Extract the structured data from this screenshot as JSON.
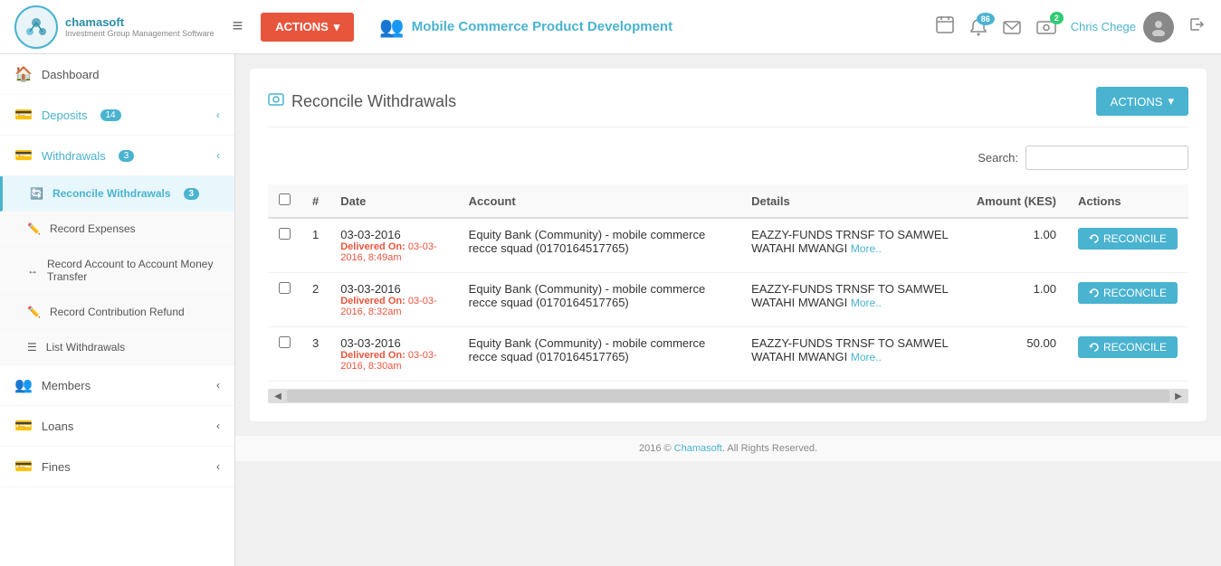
{
  "topnav": {
    "logo_text": "chamasoft",
    "logo_sub": "Investment Group Management Software",
    "hamburger": "≡",
    "actions_btn": "ACTIONS",
    "actions_arrow": "▾",
    "group_name": "Mobile Commerce Product Development",
    "notification_count": "86",
    "message_count": "2",
    "user_name": "Chris Chege",
    "avatar_symbol": "👤"
  },
  "sidebar": {
    "items": [
      {
        "label": "Dashboard",
        "icon": "🏠",
        "badge": null,
        "active": false
      },
      {
        "label": "Deposits",
        "icon": "💳",
        "badge": "14",
        "badge_color": "blue",
        "has_arrow": true,
        "active": false
      },
      {
        "label": "Withdrawals",
        "icon": "💳",
        "badge": "3",
        "badge_color": "blue",
        "has_arrow": true,
        "active": true
      }
    ],
    "sub_items": [
      {
        "label": "Reconcile Withdrawals",
        "icon": "🔄",
        "badge": "3",
        "active": true
      },
      {
        "label": "Record Expenses",
        "icon": "✏️",
        "badge": null,
        "active": false
      },
      {
        "label": "Record Account to Account Money Transfer",
        "icon": "↔",
        "badge": null,
        "active": false
      },
      {
        "label": "Record Contribution Refund",
        "icon": "✏️",
        "badge": null,
        "active": false
      },
      {
        "label": "List Withdrawals",
        "icon": "☰",
        "badge": null,
        "active": false
      }
    ],
    "bottom_items": [
      {
        "label": "Members",
        "icon": "👥",
        "has_arrow": true
      },
      {
        "label": "Loans",
        "icon": "💳",
        "has_arrow": true
      },
      {
        "label": "Fines",
        "icon": "💳",
        "has_arrow": true
      }
    ]
  },
  "page": {
    "title": "Reconcile Withdrawals",
    "title_icon": "💳",
    "actions_btn": "ACTIONS",
    "actions_arrow": "▾",
    "search_label": "Search:",
    "search_placeholder": ""
  },
  "table": {
    "columns": [
      "",
      "#",
      "Date",
      "Account",
      "Details",
      "Amount (KES)",
      "Actions"
    ],
    "rows": [
      {
        "num": "1",
        "date": "03-03-2016",
        "delivered_label": "Delivered On:",
        "delivered": "03-03-2016, 8:49am",
        "account": "Equity Bank (Community) - mobile commerce recce squad (0170164517765)",
        "details": "EAZZY-FUNDS TRNSF TO SAMWEL WATAHI MWANGI",
        "more": "More..",
        "amount": "1.00",
        "action": "RECONCILE"
      },
      {
        "num": "2",
        "date": "03-03-2016",
        "delivered_label": "Delivered On:",
        "delivered": "03-03-2016, 8:32am",
        "account": "Equity Bank (Community) - mobile commerce recce squad (0170164517765)",
        "details": "EAZZY-FUNDS TRNSF TO SAMWEL WATAHI MWANGI",
        "more": "More..",
        "amount": "1.00",
        "action": "RECONCILE"
      },
      {
        "num": "3",
        "date": "03-03-2016",
        "delivered_label": "Delivered On:",
        "delivered": "03-03-2016, 8:30am",
        "account": "Equity Bank (Community) - mobile commerce recce squad (0170164517765)",
        "details": "EAZZY-FUNDS TRNSF TO SAMWEL WATAHI MWANGI",
        "more": "More..",
        "amount": "50.00",
        "action": "RECONCILE"
      }
    ]
  },
  "footer": {
    "text": "2016 © Chamasoft. All Rights Reserved."
  },
  "colors": {
    "teal": "#4ab3d0",
    "orange": "#e8553d",
    "blue_badge": "#4ab3d0"
  }
}
